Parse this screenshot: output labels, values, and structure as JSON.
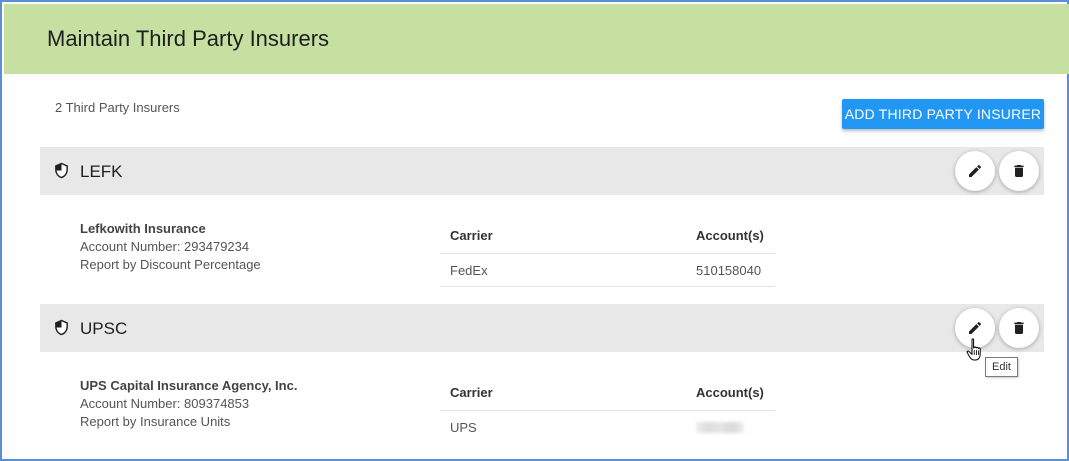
{
  "page": {
    "title": "Maintain Third Party Insurers",
    "count_text": "2 Third Party Insurers",
    "add_button_label": "ADD THIRD PARTY INSURER"
  },
  "table_headers": {
    "carrier": "Carrier",
    "accounts": "Account(s)"
  },
  "insurers": [
    {
      "code": "LEFK",
      "name": "Lefkowith Insurance",
      "account_number": "Account Number: 293479234",
      "report_by": "Report by Discount Percentage",
      "rows": [
        {
          "carrier": "FedEx",
          "accounts": "510158040"
        }
      ]
    },
    {
      "code": "UPSC",
      "name": "UPS Capital Insurance Agency, Inc.",
      "account_number": "Account Number: 809374853",
      "report_by": "Report by Insurance Units",
      "rows": [
        {
          "carrier": "UPS",
          "accounts": ""
        }
      ]
    }
  ],
  "tooltip": {
    "text": "Edit"
  },
  "icons": {
    "insurer": "shield-icon",
    "edit": "pencil-icon",
    "delete": "trash-icon",
    "pointer": "hand-pointer-icon"
  },
  "colors": {
    "header_bg": "#c6e0a2",
    "primary_button": "#2196f3",
    "row_header_bg": "#e8e8e8",
    "frame_border": "#5b8fd4"
  }
}
